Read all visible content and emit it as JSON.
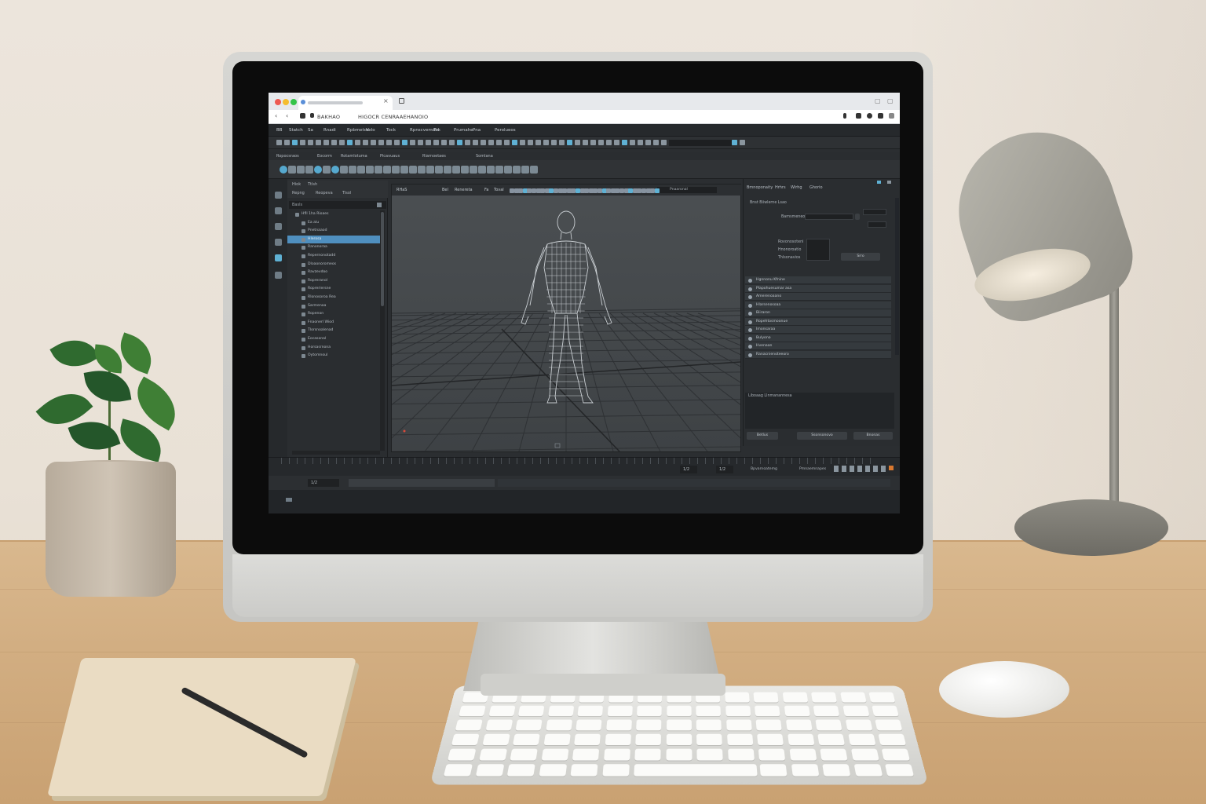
{
  "browser": {
    "tab_title": "",
    "close_glyph": "×",
    "new_tab_glyph": "+",
    "address_label": "BAKHAO",
    "address_url": "HIGOCR CENRAAEHANOIO",
    "back_glyph": "‹",
    "forward_glyph": "‹",
    "traffic_colors": [
      "#ee5a52",
      "#f5bd2f",
      "#35c449"
    ]
  },
  "app": {
    "menu": [
      "BB",
      "Statch",
      "Sa",
      "Rnadi",
      "Rpbmetos",
      "Velo",
      "Tock",
      "Rpnscvemets",
      "Tek",
      "Prumahe",
      "Pna",
      "Perolueos"
    ],
    "shelf_tabs": [
      "Ropocsraos",
      "Eocorm",
      "Rotamlotuma",
      "Picavuaus",
      "Riarnoetaes",
      "Somlana"
    ],
    "outliner": {
      "header_a": "Hiok",
      "header_b": "Ttlsh",
      "tabs": [
        "Repng",
        "Reopeva",
        "Tisol"
      ],
      "search": "Basls",
      "rows": [
        "Hfll 1ha Rioaes",
        "Ea  aiu",
        "Pnetnaaod",
        "Hlerosa",
        "Ranonoraa",
        "Repernonotadd",
        "Dloaonoromeos",
        "Ravzevdoo",
        "Ropreranol",
        "Ropreriersne",
        "Rlonosoroa  Rea",
        "Sarmenaa",
        "Ropenon",
        "Fnaonerl Wiod",
        "Tlorsnoalenad",
        "Eocasonal",
        "Horsasrnona",
        "Oytomnoul"
      ],
      "selected_index": 3
    },
    "viewport": {
      "menu": [
        "RHaS",
        "Bel",
        "Renereta",
        "Fa",
        "Toval"
      ],
      "field_label": "Pnaaronal"
    },
    "right_panel": {
      "tabs": [
        "Bmnoponaity",
        "Hrhrs",
        "Wirhg",
        "Ghorio"
      ],
      "section_title": "Bnst  Biiwlerne  Lsao",
      "label_1": "Barnsmeneo",
      "labels": [
        "Rovonosoteni",
        "Hnonoroatio",
        "Thlsonavios"
      ],
      "button": "Srro",
      "layers": [
        "Hgnnonu Kfnine",
        "Plapohuesumar asa",
        "Amerenoaano",
        "Hlarsenosoaa",
        "Biiraron",
        "Ropehtosmoonue",
        "Imonsaraa",
        "Bulyono",
        "Hvenaan",
        "Ranacnienoteeoro"
      ],
      "notes_label": "Liboaag   Llnmanannesa",
      "buttons": [
        "Betlus",
        "Ssonsonovo",
        "Bnonas"
      ]
    },
    "timeline": {
      "frame_a": "1/2",
      "frame_b": "1/2",
      "status_a": "Bpvarnoatemg",
      "status_b": "Pmnaemnapes",
      "range_start": "1/2"
    }
  },
  "colors": {
    "accent": "#5fb1d4",
    "selection": "#4f8fbf",
    "ui_dark": "#2b2e31"
  }
}
